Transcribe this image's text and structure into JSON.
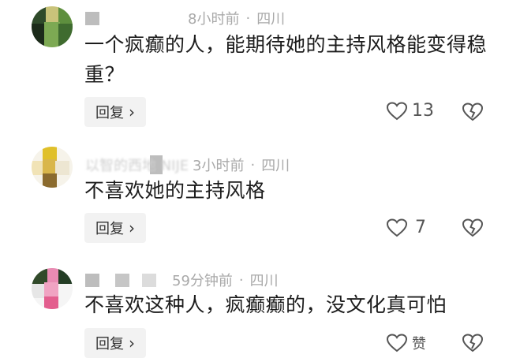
{
  "comments": [
    {
      "time": "8小时前",
      "location": "四川",
      "text": "一个疯癫的人，能期待她的主持风格能变得稳重？",
      "reply_label": "回复",
      "likes": "13"
    },
    {
      "username_fragment": "以智的西地 NIJE",
      "time": "3小时前",
      "location": "四川",
      "text": "不喜欢她的主持风格",
      "reply_label": "回复",
      "likes": "7"
    },
    {
      "time": "59分钟前",
      "location": "四川",
      "text": "不喜欢这种人，疯癫癫的，没文化真可怕",
      "reply_label": "回复",
      "likes": "赞"
    }
  ],
  "separator": "·",
  "colors": {
    "meta": "#a9a9a9",
    "text": "#1c1c1c",
    "reply_bg": "#f2f2f2"
  },
  "icons": {
    "like": "heart-outline-icon",
    "dislike": "broken-heart-icon",
    "reply_arrow": "chevron-right-icon"
  }
}
